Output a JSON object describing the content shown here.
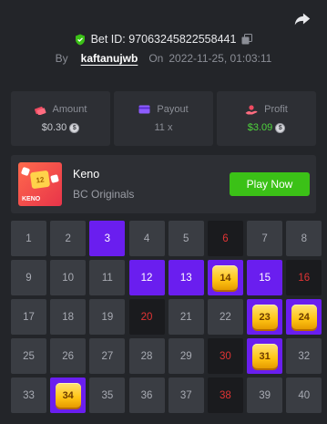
{
  "header": {
    "bet_id_label": "Bet ID: 97063245822558441",
    "by_label": "By",
    "username": "kaftanujwb",
    "on_label": "On",
    "date": "2022-11-25, 01:03:11"
  },
  "stats": [
    {
      "label": "Amount",
      "value": "$0.30",
      "icon": "amount-icon",
      "color": "#c9cbd1"
    },
    {
      "label": "Payout",
      "value": "11 x",
      "icon": "payout-card-icon",
      "color": "#8b8e96"
    },
    {
      "label": "Profit",
      "value": "$3.09",
      "icon": "profit-icon",
      "color": "#4ed43c"
    }
  ],
  "game": {
    "name": "Keno",
    "provider": "BC Originals",
    "play_label": "Play Now",
    "thumb_number": "12",
    "thumb_label": "KENO"
  },
  "grid": {
    "cells": [
      {
        "n": "1",
        "s": "normal"
      },
      {
        "n": "2",
        "s": "normal"
      },
      {
        "n": "3",
        "s": "selected"
      },
      {
        "n": "4",
        "s": "normal"
      },
      {
        "n": "5",
        "s": "normal"
      },
      {
        "n": "6",
        "s": "drawn"
      },
      {
        "n": "7",
        "s": "normal"
      },
      {
        "n": "8",
        "s": "normal"
      },
      {
        "n": "9",
        "s": "normal"
      },
      {
        "n": "10",
        "s": "normal"
      },
      {
        "n": "11",
        "s": "normal"
      },
      {
        "n": "12",
        "s": "selected"
      },
      {
        "n": "13",
        "s": "selected"
      },
      {
        "n": "14",
        "s": "hit"
      },
      {
        "n": "15",
        "s": "selected"
      },
      {
        "n": "16",
        "s": "drawn"
      },
      {
        "n": "17",
        "s": "normal"
      },
      {
        "n": "18",
        "s": "normal"
      },
      {
        "n": "19",
        "s": "normal"
      },
      {
        "n": "20",
        "s": "drawn"
      },
      {
        "n": "21",
        "s": "normal"
      },
      {
        "n": "22",
        "s": "normal"
      },
      {
        "n": "23",
        "s": "hit"
      },
      {
        "n": "24",
        "s": "hit"
      },
      {
        "n": "25",
        "s": "normal"
      },
      {
        "n": "26",
        "s": "normal"
      },
      {
        "n": "27",
        "s": "normal"
      },
      {
        "n": "28",
        "s": "normal"
      },
      {
        "n": "29",
        "s": "normal"
      },
      {
        "n": "30",
        "s": "drawn"
      },
      {
        "n": "31",
        "s": "hit"
      },
      {
        "n": "32",
        "s": "normal"
      },
      {
        "n": "33",
        "s": "normal"
      },
      {
        "n": "34",
        "s": "hit"
      },
      {
        "n": "35",
        "s": "normal"
      },
      {
        "n": "36",
        "s": "normal"
      },
      {
        "n": "37",
        "s": "normal"
      },
      {
        "n": "38",
        "s": "drawn"
      },
      {
        "n": "39",
        "s": "normal"
      },
      {
        "n": "40",
        "s": "normal"
      }
    ]
  },
  "colors": {
    "background": "#232529",
    "panel": "#2d2f34",
    "cell": "#3a3d43",
    "selected": "#6a1eef",
    "drawn_miss": "#e13434",
    "gem": "#ffc414",
    "play_button": "#3bc117",
    "profit": "#4ed43c",
    "verified": "#3bc117"
  }
}
